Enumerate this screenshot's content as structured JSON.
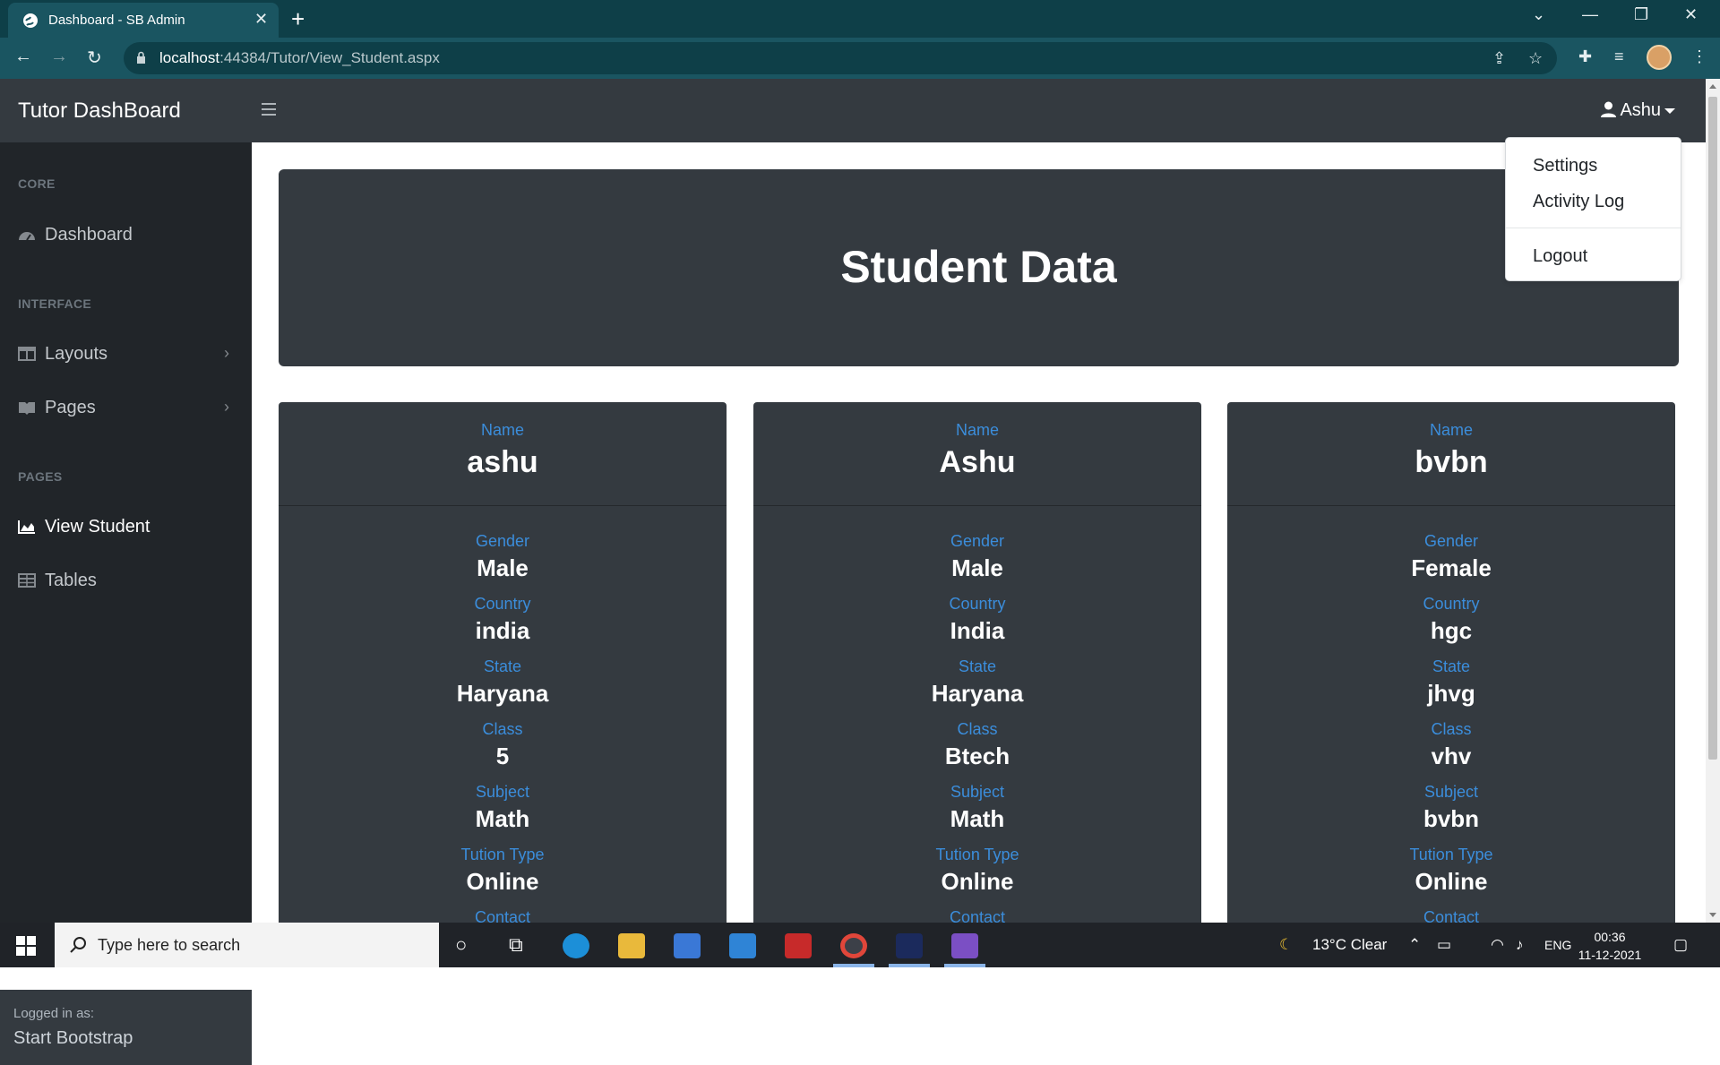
{
  "browser": {
    "tab_title": "Dashboard - SB Admin",
    "url_host": "localhost",
    "url_rest": ":44384/Tutor/View_Student.aspx"
  },
  "app": {
    "brand": "Tutor DashBoard",
    "user": "Ashu"
  },
  "user_menu": {
    "items": [
      "Settings",
      "Activity Log"
    ],
    "logout": "Logout"
  },
  "sidebar": {
    "sections": [
      {
        "heading": "CORE"
      },
      {
        "heading": "INTERFACE"
      },
      {
        "heading": "PAGES"
      }
    ],
    "items": [
      {
        "label": "Dashboard",
        "icon": "tachometer-icon"
      },
      {
        "label": "Layouts",
        "icon": "columns-icon"
      },
      {
        "label": "Pages",
        "icon": "book-icon"
      },
      {
        "label": "View Student",
        "icon": "chart-area-icon"
      },
      {
        "label": "Tables",
        "icon": "table-icon"
      }
    ],
    "footer_label": "Logged in as:",
    "footer_value": "Start Bootstrap"
  },
  "page": {
    "title": "Student Data"
  },
  "labels": {
    "name": "Name",
    "gender": "Gender",
    "country": "Country",
    "state": "State",
    "class": "Class",
    "subject": "Subject",
    "tution_type": "Tution Type",
    "contact": "Contact"
  },
  "students": [
    {
      "name": "ashu",
      "gender": "Male",
      "country": "india",
      "state": "Haryana",
      "class": "5",
      "subject": "Math",
      "tution_type": "Online"
    },
    {
      "name": "Ashu",
      "gender": "Male",
      "country": "India",
      "state": "Haryana",
      "class": "Btech",
      "subject": "Math",
      "tution_type": "Online"
    },
    {
      "name": "bvbn",
      "gender": "Female",
      "country": "hgc",
      "state": "jhvg",
      "class": "vhv",
      "subject": "bvbn",
      "tution_type": "Online"
    }
  ],
  "taskbar": {
    "search_placeholder": "Type here to search",
    "weather": "13°C  Clear",
    "lang": "ENG",
    "time": "00:36",
    "date": "11-12-2021"
  },
  "colors": {
    "navbar": "#343a40",
    "sidebar": "#212529",
    "label_blue": "#3b8ddb",
    "browser_frame": "#0e3f48"
  }
}
